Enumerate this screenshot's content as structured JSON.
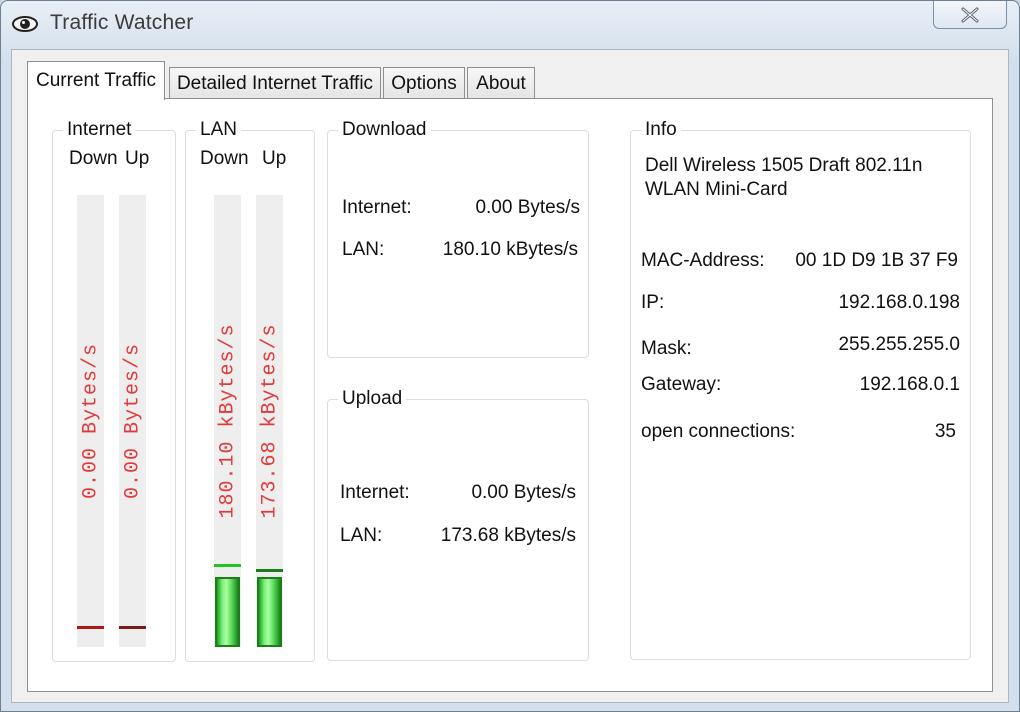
{
  "window": {
    "title": "Traffic Watcher",
    "icon": "eye-icon",
    "close_icon": "close-icon"
  },
  "tabs": [
    {
      "label": "Current Traffic",
      "active": true
    },
    {
      "label": "Detailed Internet Traffic",
      "active": false
    },
    {
      "label": "Options",
      "active": false
    },
    {
      "label": "About",
      "active": false
    }
  ],
  "meters": {
    "internet": {
      "title": "Internet",
      "down_label": "Down",
      "up_label": "Up",
      "down_text": "0.00 Bytes/s",
      "up_text": "0.00 Bytes/s"
    },
    "lan": {
      "title": "LAN",
      "down_label": "Down",
      "up_label": "Up",
      "down_text": "180.10 kBytes/s",
      "up_text": "173.68 kBytes/s"
    }
  },
  "download": {
    "title": "Download",
    "internet_label": "Internet:",
    "internet_value": "0.00 Bytes/s",
    "lan_label": "LAN:",
    "lan_value": "180.10 kBytes/s"
  },
  "upload": {
    "title": "Upload",
    "internet_label": "Internet:",
    "internet_value": "0.00 Bytes/s",
    "lan_label": "LAN:",
    "lan_value": "173.68 kBytes/s"
  },
  "info": {
    "title": "Info",
    "adapter_line1": "Dell Wireless 1505 Draft 802.11n",
    "adapter_line2": "WLAN Mini-Card",
    "mac_label": "MAC-Address:",
    "mac_value": "00 1D D9 1B 37 F9",
    "ip_label": "IP:",
    "ip_value": "192.168.0.198",
    "mask_label": "Mask:",
    "mask_value": "255.255.255.0",
    "gateway_label": "Gateway:",
    "gateway_value": "192.168.0.1",
    "connections_label": "open connections:",
    "connections_value": "35"
  },
  "colors": {
    "meter_text": "#e23a3a",
    "peak_internet": "#b01515",
    "peak_lan": "#22c422",
    "bar_green": "#3fd83f"
  }
}
